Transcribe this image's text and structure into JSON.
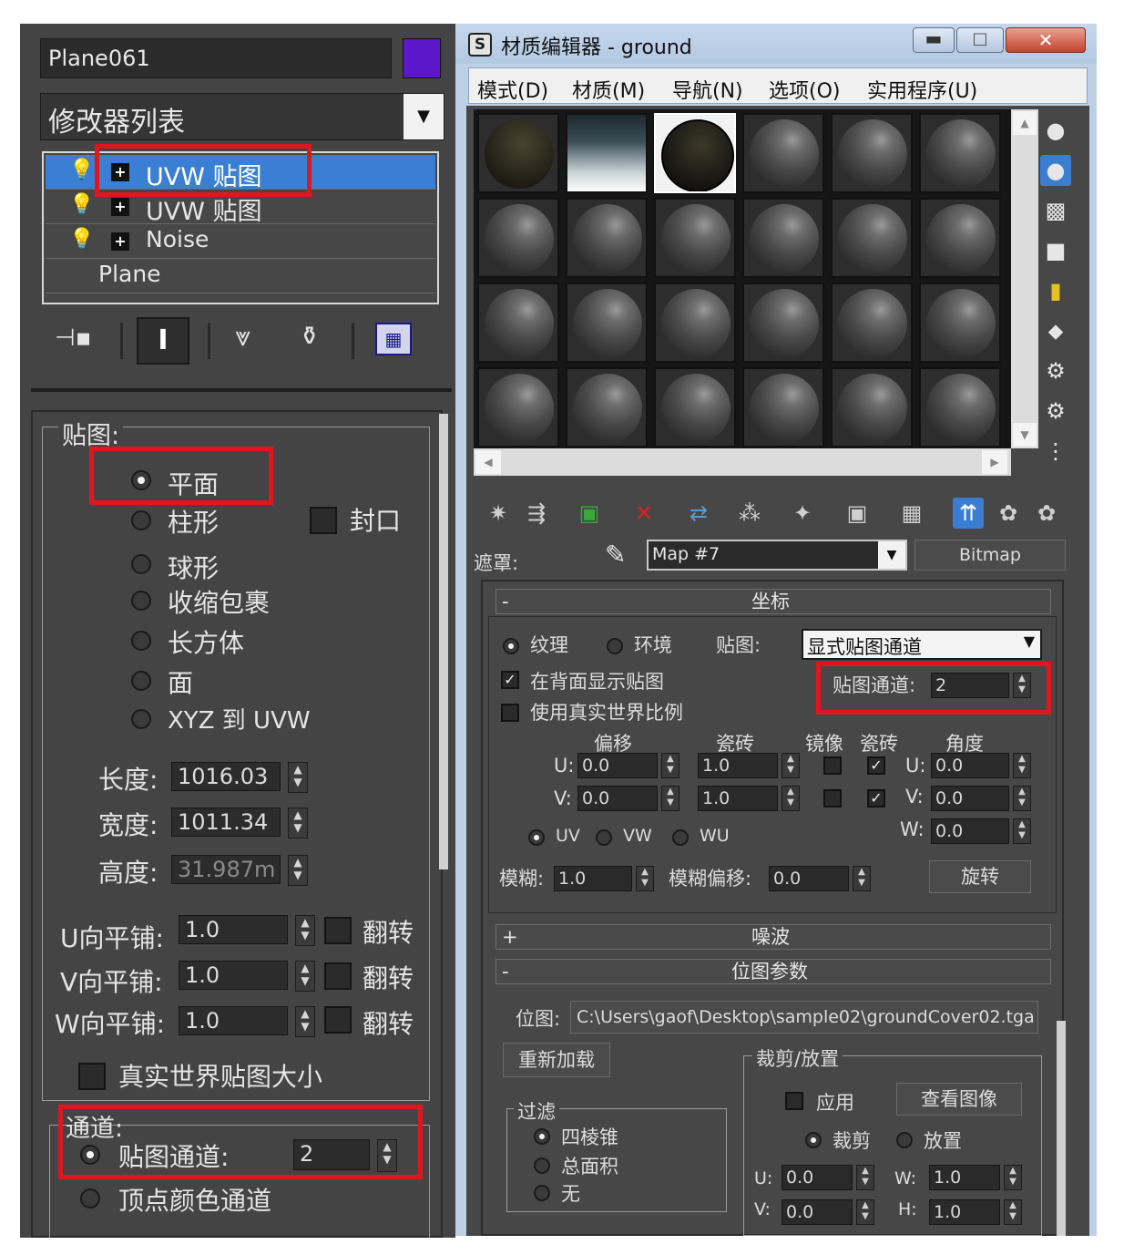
{
  "modify_panel": {
    "object_name": "Plane061",
    "object_color": "#5a16c8",
    "modifier_list_label": "修改器列表",
    "stack": [
      {
        "label": "UVW 贴图",
        "selected": true
      },
      {
        "label": "UVW 贴图",
        "selected": false
      },
      {
        "label": "Noise",
        "selected": false
      },
      {
        "label": "Plane",
        "selected": false
      }
    ],
    "mapping": {
      "group_label": "贴图:",
      "options": [
        "平面",
        "柱形",
        "球形",
        "收缩包裹",
        "长方体",
        "面",
        "XYZ 到 UVW"
      ],
      "selected": "平面",
      "cap_label": "封口",
      "length_label": "长度:",
      "length_value": "1016.03",
      "width_label": "宽度:",
      "width_value": "1011.34",
      "height_label": "高度:",
      "height_value": "31.987m",
      "u_tile_label": "U向平铺:",
      "u_tile_value": "1.0",
      "v_tile_label": "V向平铺:",
      "v_tile_value": "1.0",
      "w_tile_label": "W向平铺:",
      "w_tile_value": "1.0",
      "flip_label": "翻转",
      "real_world_label": "真实世界贴图大小"
    },
    "channel": {
      "group_label": "通道:",
      "map_channel_label": "贴图通道:",
      "map_channel_value": "2",
      "vertex_color_label": "顶点颜色通道"
    }
  },
  "material_editor": {
    "title": "材质编辑器 - ground",
    "app_icon": "3ds-max-logo-icon",
    "menu": [
      "模式(D)",
      "材质(M)",
      "导航(N)",
      "选项(O)",
      "实用程序(U)"
    ],
    "mask_label": "遮罩:",
    "map_name": "Map #7",
    "map_type": "Bitmap",
    "coordinates": {
      "rollout_title": "坐标",
      "texture_label": "纹理",
      "environ_label": "环境",
      "mapping_label": "贴图:",
      "mapping_value": "显式贴图通道",
      "show_back_label": "在背面显示贴图",
      "real_world_label": "使用真实世界比例",
      "map_channel_label": "贴图通道:",
      "map_channel_value": "2",
      "offset_label": "偏移",
      "tiling_label": "瓷砖",
      "mirror_label": "镜像",
      "tile_label": "瓷砖",
      "angle_label": "角度",
      "u_label": "U:",
      "v_label": "V:",
      "w_label": "W:",
      "u_offset": "0.0",
      "v_offset": "0.0",
      "u_tiling": "1.0",
      "v_tiling": "1.0",
      "u_angle": "0.0",
      "v_angle": "0.0",
      "w_angle": "0.0",
      "uv_label": "UV",
      "vw_label": "VW",
      "wu_label": "WU",
      "blur_label": "模糊:",
      "blur_value": "1.0",
      "blur_offset_label": "模糊偏移:",
      "blur_offset_value": "0.0",
      "rotate_label": "旋转"
    },
    "noise_rollout": "噪波",
    "bitmap_params": {
      "rollout_title": "位图参数",
      "bitmap_label": "位图:",
      "bitmap_path": "C:\\Users\\gaof\\Desktop\\sample02\\groundCover02.tga",
      "reload_label": "重新加载",
      "crop_group": "裁剪/放置",
      "apply_label": "应用",
      "view_image_label": "查看图像",
      "crop_label": "裁剪",
      "place_label": "放置",
      "filter_group": "过滤",
      "filter_options": [
        "四棱锥",
        "总面积",
        "无"
      ],
      "u_label": "U:",
      "v_label": "V:",
      "w_label": "W:",
      "h_label": "H:",
      "u_value": "0.0",
      "v_value": "0.0",
      "w_value": "1.0",
      "h_value": "1.0"
    }
  }
}
